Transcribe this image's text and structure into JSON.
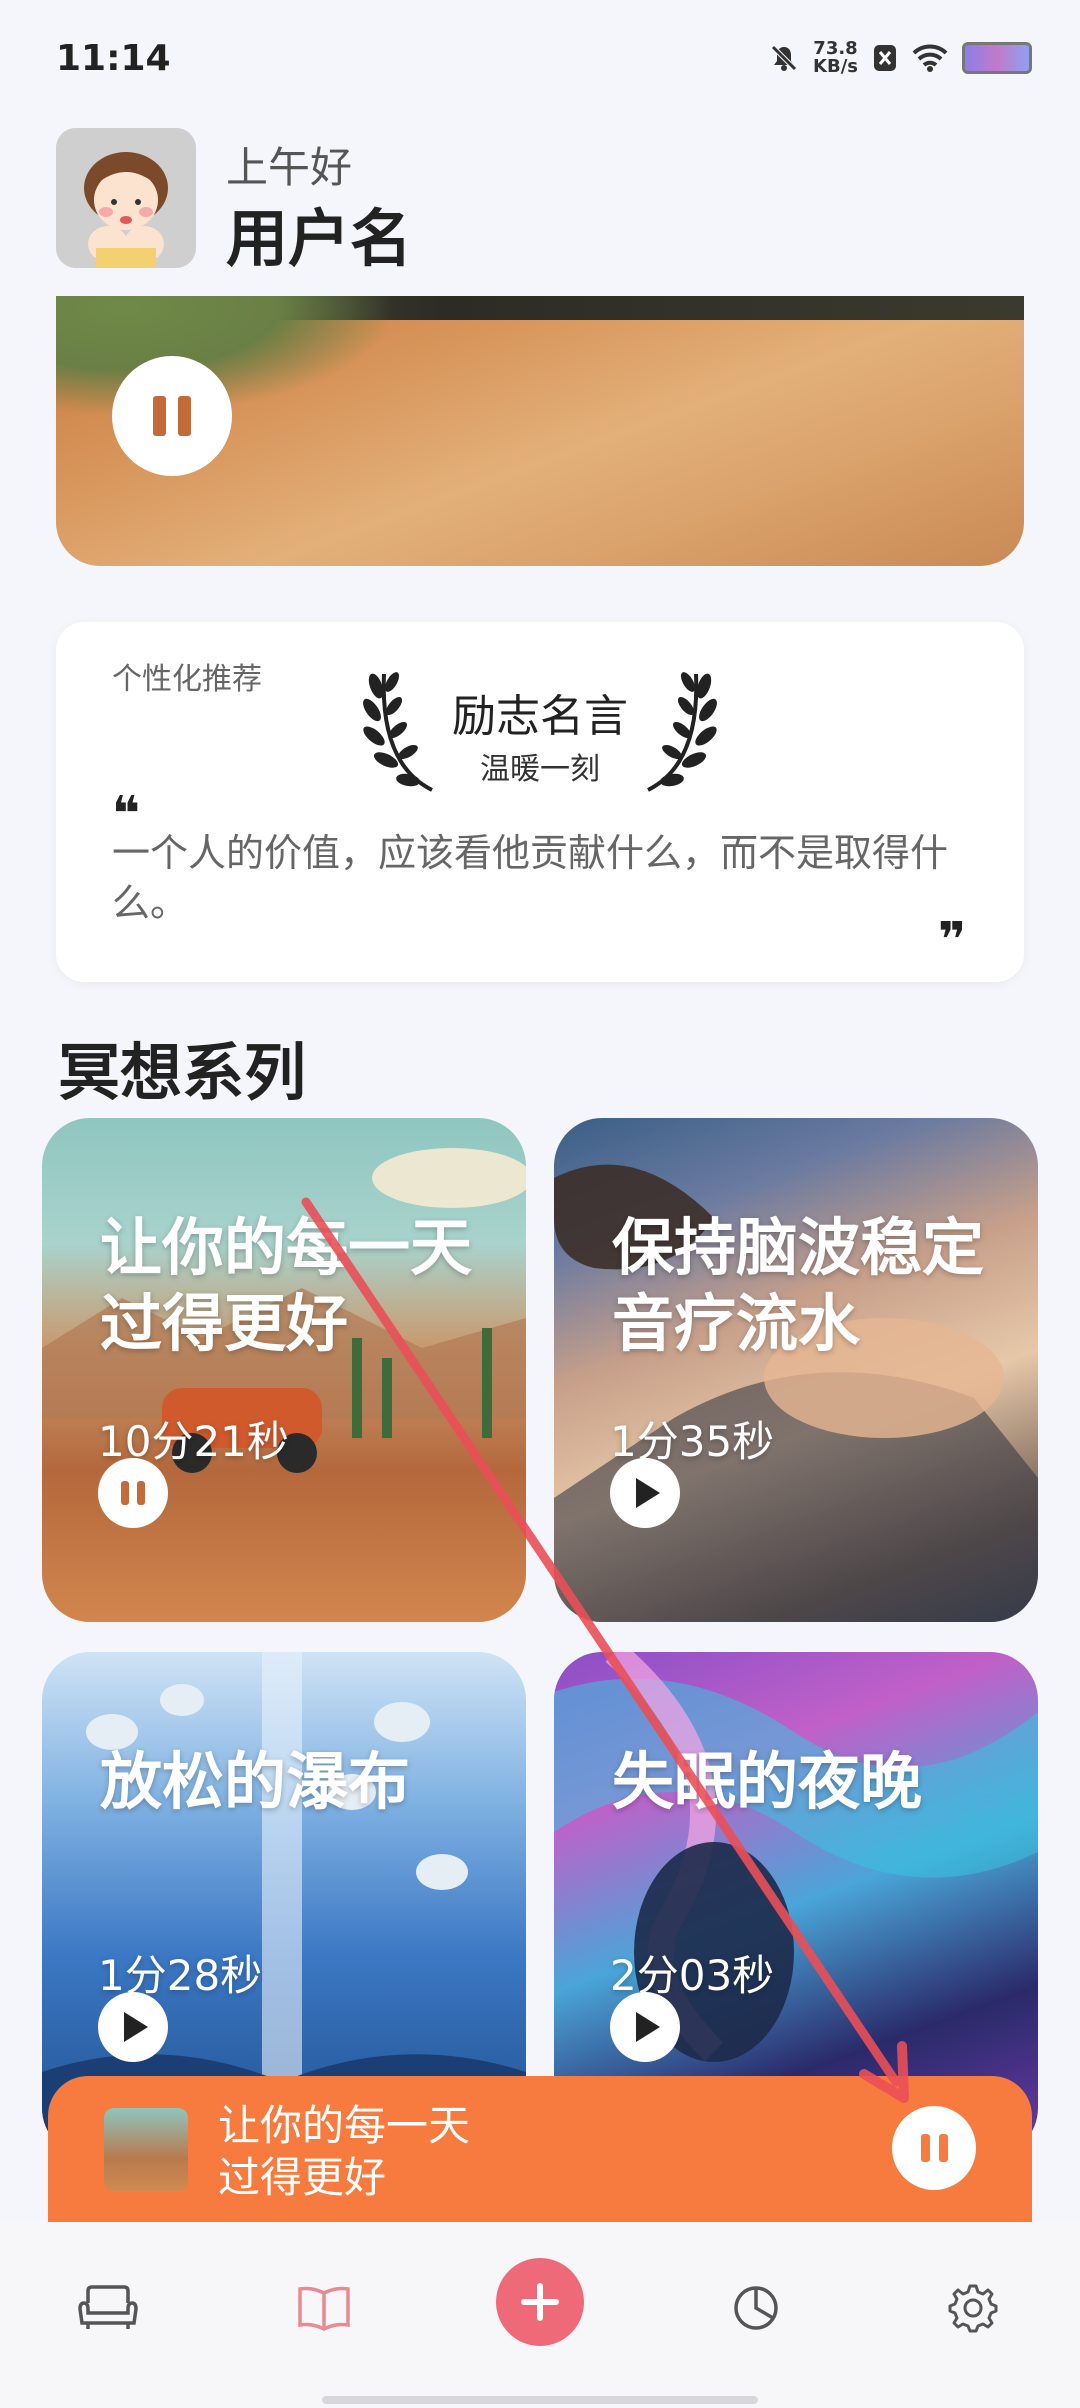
{
  "status_bar": {
    "time": "11:14",
    "speed_value": "73.8",
    "speed_unit": "KB/s"
  },
  "header": {
    "greeting": "上午好",
    "username": "用户名"
  },
  "quote_card": {
    "tag": "个性化推荐",
    "title": "励志名言",
    "subtitle": "温暖一刻",
    "open_mark": "❝",
    "text": "一个人的价值，应该看他贡献什么，而不是取得什么。",
    "close_mark": "❞"
  },
  "section": {
    "title": "冥想系列",
    "cards": [
      {
        "title_line1": "让你的每一天",
        "title_line2": "过得更好",
        "duration": "10分21秒",
        "state": "playing"
      },
      {
        "title_line1": "保持脑波稳定",
        "title_line2": "音疗流水",
        "duration": "1分35秒",
        "state": "paused"
      },
      {
        "title_line1": "放松的瀑布",
        "title_line2": "",
        "duration": "1分28秒",
        "state": "paused"
      },
      {
        "title_line1": "失眠的夜晚",
        "title_line2": "",
        "duration": "2分03秒",
        "state": "paused"
      }
    ]
  },
  "now_playing": {
    "title_line1": "让你的每一天",
    "title_line2": "过得更好"
  },
  "nav": {
    "items": [
      {
        "name": "sofa-icon",
        "active": false
      },
      {
        "name": "book-icon",
        "active": true
      },
      {
        "name": "add-icon",
        "active": false
      },
      {
        "name": "pie-chart-icon",
        "active": false
      },
      {
        "name": "gear-icon",
        "active": false
      }
    ]
  },
  "colors": {
    "accent": "#f77b3e",
    "add_button": "#ee6a78",
    "active_nav": "#e88a90",
    "arrow": "#ea4f57"
  }
}
